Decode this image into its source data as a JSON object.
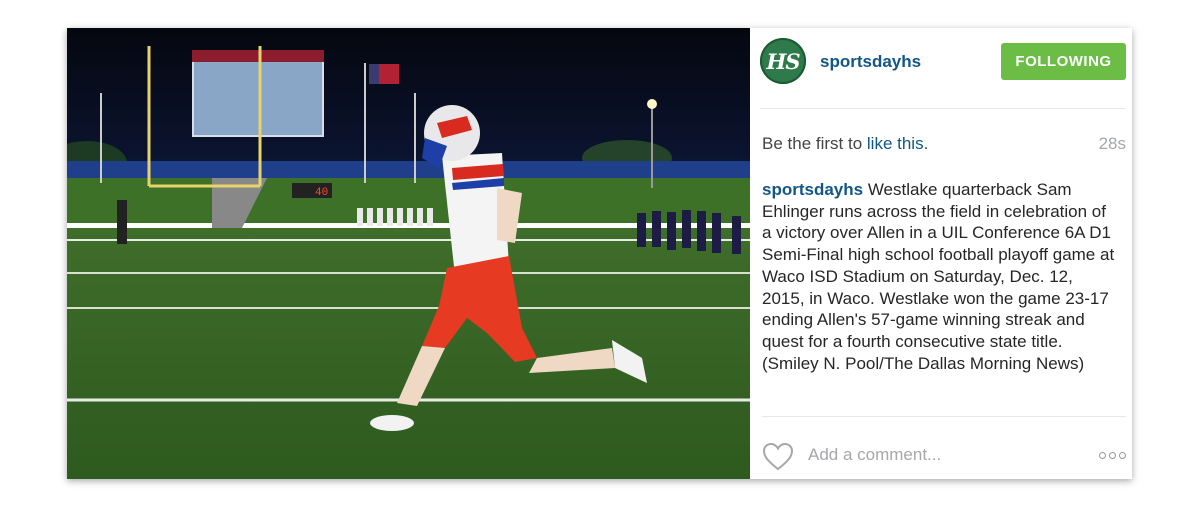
{
  "post": {
    "image_alt": "Westlake quarterback running across the field at night",
    "scoreboard_text": "40"
  },
  "header": {
    "avatar_text": "HS",
    "username": "sportsdayhs",
    "follow_label": "FOLLOWING"
  },
  "likes": {
    "prefix": "Be the first to ",
    "link": "like this",
    "suffix": ".",
    "time": "28s"
  },
  "caption": {
    "user": "sportsdayhs",
    "text": " Westlake quarterback Sam Ehlinger runs across the field in celebration of a victory over Allen in a UIL Conference 6A D1 Semi-Final high school football playoff game at Waco ISD Stadium on Saturday, Dec. 12, 2015, in Waco. Westlake won the game 23-17 ending Allen's 57-game winning streak and quest for a fourth consecutive state title. (Smiley N. Pool/The Dallas Morning News)"
  },
  "footer": {
    "comment_placeholder": "Add a comment...",
    "heart_icon": "heart-outline-icon",
    "more_icon": "more-options-icon"
  },
  "colors": {
    "link": "#125688",
    "follow_bg": "#6cbd45",
    "avatar_bg": "#2f7a4a"
  }
}
